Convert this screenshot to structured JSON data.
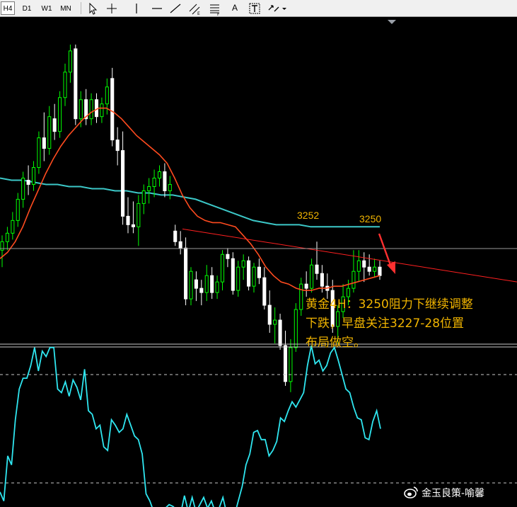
{
  "toolbar": {
    "timeframes": [
      "H4",
      "D1",
      "W1",
      "MN"
    ],
    "active_timeframe": "H4",
    "tools": [
      {
        "name": "cursor-icon"
      },
      {
        "name": "crosshair-icon"
      },
      {
        "name": "vertical-line-icon"
      },
      {
        "name": "horizontal-line-icon"
      },
      {
        "name": "trendline-icon"
      },
      {
        "name": "equidistant-channel-icon"
      },
      {
        "name": "fibonacci-icon"
      },
      {
        "name": "text-icon"
      },
      {
        "name": "text-label-icon"
      },
      {
        "name": "arrows-icon"
      },
      {
        "name": "dropdown-icon"
      }
    ],
    "text_tool_label": "A"
  },
  "annotations": {
    "resistance_left": "3252",
    "resistance_right": "3250",
    "note_lines": [
      "黄金4H：3250阻力下继续调整",
      "下跌，早盘关注3227-28位置",
      "布局做空。"
    ]
  },
  "watermark": "金玉良策-喻馨",
  "colors": {
    "background": "#000000",
    "candle_up": "#00ff00",
    "candle_down": "#ffffff",
    "ma_fast": "#ff4b1f",
    "ma_slow": "#3cc8c8",
    "trendline": "#ff2020",
    "oscillator": "#2fe6f0",
    "annotation": "#f0b400",
    "arrow": "#ff3030"
  },
  "chart_data": [
    {
      "type": "candlestick",
      "timeframe": "H4",
      "ylim": [
        3205,
        3350
      ],
      "candles": [
        {
          "o": 3244,
          "h": 3251,
          "l": 3236,
          "c": 3248
        },
        {
          "o": 3248,
          "h": 3255,
          "l": 3244,
          "c": 3252
        },
        {
          "o": 3252,
          "h": 3262,
          "l": 3249,
          "c": 3258
        },
        {
          "o": 3258,
          "h": 3271,
          "l": 3255,
          "c": 3268
        },
        {
          "o": 3268,
          "h": 3281,
          "l": 3264,
          "c": 3278
        },
        {
          "o": 3277,
          "h": 3284,
          "l": 3270,
          "c": 3275
        },
        {
          "o": 3275,
          "h": 3286,
          "l": 3272,
          "c": 3283
        },
        {
          "o": 3283,
          "h": 3300,
          "l": 3280,
          "c": 3297
        },
        {
          "o": 3297,
          "h": 3309,
          "l": 3286,
          "c": 3292
        },
        {
          "o": 3292,
          "h": 3312,
          "l": 3289,
          "c": 3307
        },
        {
          "o": 3306,
          "h": 3313,
          "l": 3296,
          "c": 3300
        },
        {
          "o": 3300,
          "h": 3319,
          "l": 3297,
          "c": 3316
        },
        {
          "o": 3316,
          "h": 3332,
          "l": 3312,
          "c": 3328
        },
        {
          "o": 3328,
          "h": 3341,
          "l": 3323,
          "c": 3338
        },
        {
          "o": 3339,
          "h": 3341,
          "l": 3303,
          "c": 3306
        },
        {
          "o": 3306,
          "h": 3319,
          "l": 3302,
          "c": 3315
        },
        {
          "o": 3315,
          "h": 3320,
          "l": 3303,
          "c": 3306
        },
        {
          "o": 3306,
          "h": 3318,
          "l": 3303,
          "c": 3315
        },
        {
          "o": 3315,
          "h": 3318,
          "l": 3304,
          "c": 3307
        },
        {
          "o": 3307,
          "h": 3316,
          "l": 3304,
          "c": 3313
        },
        {
          "o": 3313,
          "h": 3325,
          "l": 3308,
          "c": 3321
        },
        {
          "o": 3325,
          "h": 3330,
          "l": 3293,
          "c": 3296
        },
        {
          "o": 3296,
          "h": 3302,
          "l": 3284,
          "c": 3291
        },
        {
          "o": 3291,
          "h": 3300,
          "l": 3256,
          "c": 3260
        },
        {
          "o": 3260,
          "h": 3269,
          "l": 3252,
          "c": 3256
        },
        {
          "o": 3256,
          "h": 3267,
          "l": 3252,
          "c": 3255
        },
        {
          "o": 3255,
          "h": 3270,
          "l": 3246,
          "c": 3266
        },
        {
          "o": 3266,
          "h": 3275,
          "l": 3261,
          "c": 3272
        },
        {
          "o": 3272,
          "h": 3278,
          "l": 3266,
          "c": 3274
        },
        {
          "o": 3274,
          "h": 3282,
          "l": 3269,
          "c": 3278
        },
        {
          "o": 3278,
          "h": 3284,
          "l": 3274,
          "c": 3281
        },
        {
          "o": 3281,
          "h": 3285,
          "l": 3269,
          "c": 3272
        },
        {
          "o": 3272,
          "h": 3279,
          "l": 3268,
          "c": 3275
        },
        {
          "o": 3253,
          "h": 3256,
          "l": 3246,
          "c": 3248
        },
        {
          "o": 3248,
          "h": 3253,
          "l": 3242,
          "c": 3245
        },
        {
          "o": 3245,
          "h": 3250,
          "l": 3218,
          "c": 3221
        },
        {
          "o": 3221,
          "h": 3236,
          "l": 3218,
          "c": 3234
        },
        {
          "o": 3230,
          "h": 3234,
          "l": 3220,
          "c": 3226
        },
        {
          "o": 3226,
          "h": 3230,
          "l": 3218,
          "c": 3224
        },
        {
          "o": 3224,
          "h": 3237,
          "l": 3220,
          "c": 3232
        },
        {
          "o": 3232,
          "h": 3236,
          "l": 3221,
          "c": 3224
        },
        {
          "o": 3224,
          "h": 3232,
          "l": 3221,
          "c": 3229
        },
        {
          "o": 3229,
          "h": 3244,
          "l": 3225,
          "c": 3242
        },
        {
          "o": 3242,
          "h": 3245,
          "l": 3236,
          "c": 3240
        },
        {
          "o": 3240,
          "h": 3243,
          "l": 3223,
          "c": 3225
        },
        {
          "o": 3225,
          "h": 3239,
          "l": 3222,
          "c": 3236
        },
        {
          "o": 3236,
          "h": 3242,
          "l": 3230,
          "c": 3239
        },
        {
          "o": 3239,
          "h": 3241,
          "l": 3225,
          "c": 3227
        },
        {
          "o": 3227,
          "h": 3238,
          "l": 3224,
          "c": 3236
        },
        {
          "o": 3236,
          "h": 3240,
          "l": 3228,
          "c": 3231
        },
        {
          "o": 3231,
          "h": 3236,
          "l": 3216,
          "c": 3218
        },
        {
          "o": 3218,
          "h": 3225,
          "l": 3205,
          "c": 3209
        },
        {
          "o": 3209,
          "h": 3217,
          "l": 3200,
          "c": 3211
        },
        {
          "o": 3211,
          "h": 3214,
          "l": 3197,
          "c": 3199
        },
        {
          "o": 3199,
          "h": 3206,
          "l": 3180,
          "c": 3182
        },
        {
          "o": 3182,
          "h": 3202,
          "l": 3177,
          "c": 3198
        },
        {
          "o": 3198,
          "h": 3219,
          "l": 3196,
          "c": 3216
        },
        {
          "o": 3216,
          "h": 3231,
          "l": 3213,
          "c": 3228
        },
        {
          "o": 3228,
          "h": 3234,
          "l": 3222,
          "c": 3226
        },
        {
          "o": 3226,
          "h": 3240,
          "l": 3224,
          "c": 3237
        },
        {
          "o": 3237,
          "h": 3248,
          "l": 3230,
          "c": 3233
        },
        {
          "o": 3233,
          "h": 3237,
          "l": 3224,
          "c": 3227
        },
        {
          "o": 3227,
          "h": 3233,
          "l": 3221,
          "c": 3225
        },
        {
          "o": 3225,
          "h": 3230,
          "l": 3205,
          "c": 3208
        },
        {
          "o": 3208,
          "h": 3218,
          "l": 3200,
          "c": 3215
        },
        {
          "o": 3215,
          "h": 3228,
          "l": 3212,
          "c": 3222
        },
        {
          "o": 3222,
          "h": 3230,
          "l": 3218,
          "c": 3226
        },
        {
          "o": 3226,
          "h": 3244,
          "l": 3224,
          "c": 3234
        },
        {
          "o": 3234,
          "h": 3244,
          "l": 3229,
          "c": 3239
        },
        {
          "o": 3239,
          "h": 3243,
          "l": 3229,
          "c": 3236
        },
        {
          "o": 3236,
          "h": 3242,
          "l": 3232,
          "c": 3234
        },
        {
          "o": 3234,
          "h": 3240,
          "l": 3231,
          "c": 3236
        },
        {
          "o": 3236,
          "h": 3239,
          "l": 3230,
          "c": 3232
        }
      ],
      "ma_fast": [
        3240,
        3243,
        3248,
        3255,
        3264,
        3272,
        3280,
        3287,
        3293,
        3298,
        3302,
        3306,
        3309,
        3311,
        3311,
        3309,
        3306,
        3302,
        3298,
        3295,
        3292,
        3289,
        3285,
        3278,
        3270,
        3264,
        3260,
        3258,
        3257,
        3257,
        3256,
        3255,
        3251,
        3247,
        3242,
        3236,
        3232,
        3229,
        3228,
        3226,
        3225,
        3225,
        3226,
        3226,
        3227,
        3227,
        3228,
        3229,
        3230,
        3231,
        3232
      ],
      "ma_slow": [
        3278,
        3277,
        3277,
        3276,
        3275,
        3275,
        3274,
        3274,
        3273,
        3273,
        3272,
        3272,
        3271,
        3271,
        3270,
        3270,
        3269,
        3268,
        3266,
        3264,
        3262,
        3260,
        3258,
        3257,
        3256,
        3256,
        3256,
        3255,
        3255,
        3255,
        3255,
        3255,
        3255,
        3255
      ],
      "resistance_line": {
        "from": 3254,
        "to": 3229
      },
      "annotations": [
        "3252",
        "3250"
      ]
    },
    {
      "type": "line",
      "name": "oscillator",
      "ylim": [
        0,
        100
      ],
      "levels": [
        80,
        20
      ],
      "values": [
        15,
        10,
        35,
        30,
        55,
        72,
        78,
        78,
        85,
        95,
        82,
        93,
        90,
        95,
        95,
        72,
        70,
        76,
        68,
        77,
        73,
        66,
        83,
        60,
        58,
        50,
        52,
        40,
        38,
        55,
        52,
        48,
        50,
        58,
        52,
        46,
        44,
        36,
        14,
        10,
        4,
        5,
        4,
        6,
        8,
        7,
        5,
        3,
        13,
        4,
        12,
        4,
        8,
        12,
        6,
        10,
        4,
        6,
        12,
        3,
        2,
        2,
        10,
        18,
        30,
        36,
        48,
        49,
        44,
        44,
        35,
        38,
        43,
        56,
        54,
        60,
        65,
        62,
        66,
        70,
        85,
        96,
        86,
        88,
        82,
        85,
        92,
        95,
        88,
        80,
        72,
        70,
        62,
        56,
        55,
        45,
        44,
        54,
        60,
        50
      ]
    }
  ]
}
